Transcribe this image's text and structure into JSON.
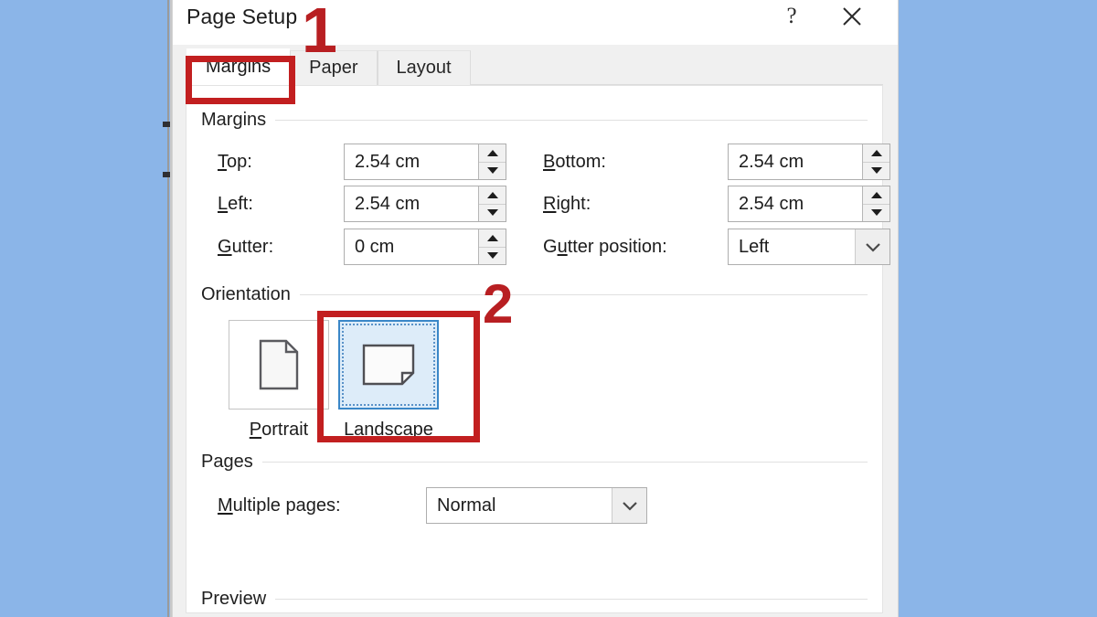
{
  "background_color": "#8bb5e8",
  "dialog": {
    "title": "Page Setup",
    "help_label": "?",
    "close_label": "close-icon",
    "tabs": [
      {
        "label": "Margins",
        "selected": true
      },
      {
        "label": "Paper",
        "selected": false
      },
      {
        "label": "Layout",
        "selected": false
      }
    ]
  },
  "margins_group": {
    "header": "Margins",
    "fields": [
      {
        "label_pre": "T",
        "label_key": "o",
        "label_post": "p:",
        "full_label": "Top:",
        "value": "2.54 cm",
        "control": "spinner"
      },
      {
        "label_pre": "",
        "label_key": "B",
        "label_post": "ottom:",
        "full_label": "Bottom:",
        "value": "2.54 cm",
        "control": "spinner"
      },
      {
        "label_pre": "",
        "label_key": "L",
        "label_post": "eft:",
        "full_label": "Left:",
        "value": "2.54 cm",
        "control": "spinner"
      },
      {
        "label_pre": "",
        "label_key": "R",
        "label_post": "ight:",
        "full_label": "Right:",
        "value": "2.54 cm",
        "control": "spinner"
      },
      {
        "label_pre": "",
        "label_key": "G",
        "label_post": "utter:",
        "full_label": "Gutter:",
        "value": "0 cm",
        "control": "spinner"
      },
      {
        "label_pre": "G",
        "label_key": "u",
        "label_post": "tter position:",
        "full_label": "Gutter position:",
        "value": "Left",
        "control": "combo"
      }
    ]
  },
  "orientation_group": {
    "header": "Orientation",
    "options": [
      {
        "caption_pre": "",
        "caption_key": "P",
        "caption_post": "ortrait",
        "full_caption": "Portrait",
        "selected": false,
        "icon": "page-portrait-icon"
      },
      {
        "caption_pre": "Land",
        "caption_key": "s",
        "caption_post": "cape",
        "full_caption": "Landscape",
        "selected": true,
        "icon": "page-landscape-icon"
      }
    ]
  },
  "pages_group": {
    "header": "Pages",
    "multiple_pages": {
      "label_pre": "",
      "label_key": "M",
      "label_post": "ultiple pages:",
      "full_label": "Multiple pages:",
      "value": "Normal"
    }
  },
  "preview_group": {
    "header": "Preview"
  },
  "annotations": {
    "accent_color": "#c21f20",
    "numeral_color": "#b81f22",
    "items": [
      {
        "number": "1",
        "targets": "margins-tab"
      },
      {
        "number": "2",
        "targets": "landscape-orientation-option"
      }
    ]
  }
}
